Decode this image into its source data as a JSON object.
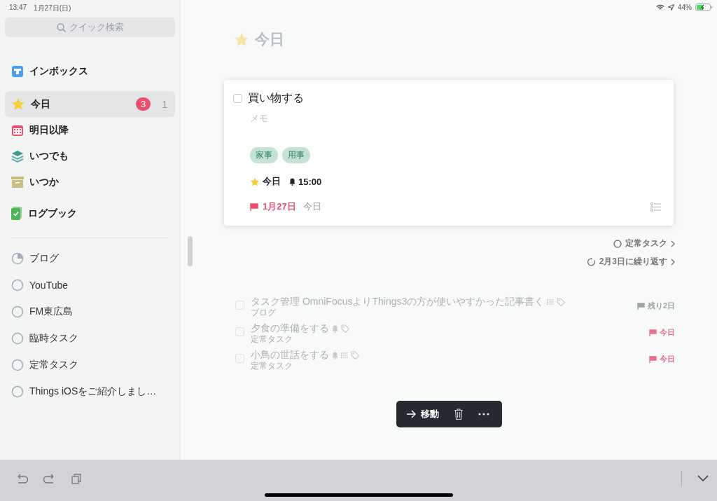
{
  "status_bar": {
    "time": "13:47",
    "date": "1月27日(日)",
    "battery": "44%"
  },
  "sidebar": {
    "search": {
      "placeholder": "クイック検索"
    },
    "groups": [
      [
        {
          "kind": "inbox",
          "label": "インボックス",
          "selected": false
        }
      ],
      [
        {
          "kind": "today",
          "label": "今日",
          "selected": true,
          "badge": "3",
          "count": "1"
        },
        {
          "kind": "upcoming",
          "label": "明日以降",
          "selected": false
        },
        {
          "kind": "anytime",
          "label": "いつでも",
          "selected": false
        },
        {
          "kind": "someday",
          "label": "いつか",
          "selected": false
        }
      ],
      [
        {
          "kind": "logbook",
          "label": "ログブック",
          "selected": false
        }
      ]
    ],
    "projects": [
      {
        "label": "ブログ",
        "kind": "started"
      },
      {
        "label": "YouTube",
        "kind": "empty"
      },
      {
        "label": "FM東広島",
        "kind": "empty"
      },
      {
        "label": "臨時タスク",
        "kind": "empty"
      },
      {
        "label": "定常タスク",
        "kind": "empty"
      },
      {
        "label": "Things iOSをご紹介しまし…",
        "kind": "empty"
      }
    ]
  },
  "main": {
    "title": "今日",
    "card": {
      "title": "買い物する",
      "checked": false,
      "notes": {
        "placeholder": "メモ"
      },
      "tags": [
        "家事",
        "用事"
      ],
      "when": "今日",
      "reminder": "15:00",
      "deadline": "1月27日",
      "deadline_relative": "今日"
    },
    "links": [
      {
        "kind": "project",
        "label": "定常タスク"
      },
      {
        "kind": "repeat",
        "label": "2月3日に繰り返す"
      }
    ],
    "tasks": [
      {
        "title": "タスク管理 OmniFocusよりThings3の方が使いやすかった記事書く",
        "project": "ブログ",
        "checked": false,
        "reminder": false,
        "checklist": true,
        "tags": true,
        "deadline": "残り2日",
        "due_today": false
      },
      {
        "title": "夕食の準備をする",
        "project": "定常タスク",
        "checked": false,
        "reminder": true,
        "checklist": false,
        "tags": true,
        "deadline": "今日",
        "due_today": true
      },
      {
        "title": "小鳥の世話をする",
        "project": "定常タスク",
        "checked": false,
        "reminder": true,
        "checklist": true,
        "tags": true,
        "deadline": "今日",
        "due_today": true
      }
    ],
    "toolbar": {
      "move": "移動"
    }
  }
}
